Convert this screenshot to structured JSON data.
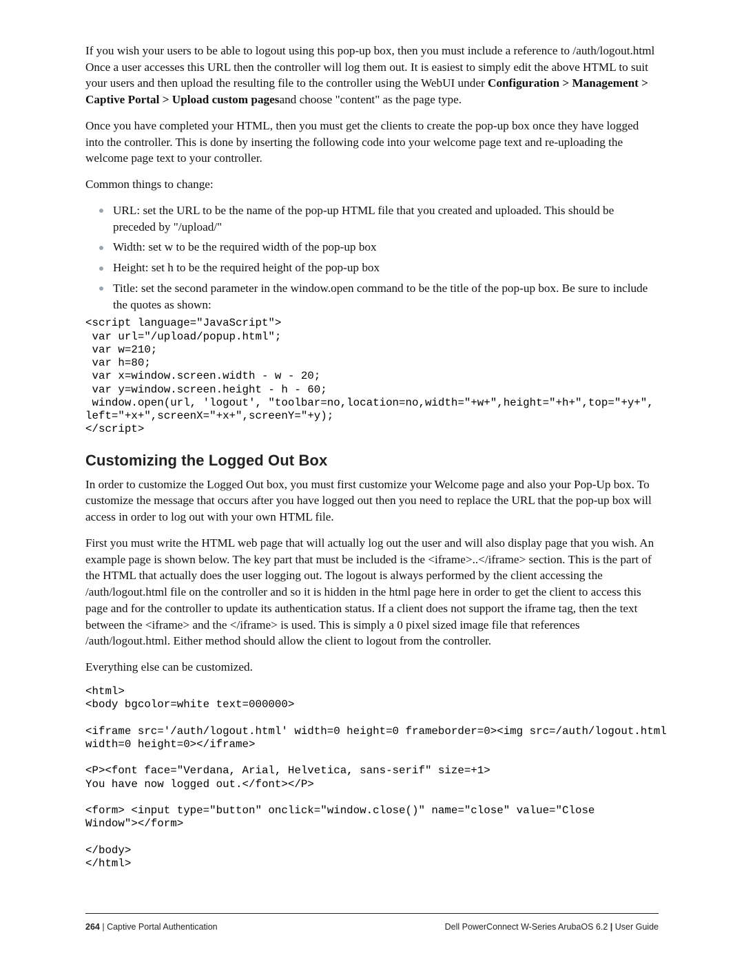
{
  "para1_part1": "If you wish your users to be able to logout using this pop-up box, then you must include a reference to /auth/logout.html Once a user accesses this URL then the controller will log them out. It is easiest to simply edit the above HTML to suit your users and then upload the resulting file to the controller using the WebUI under ",
  "para1_bold": "Configuration > Management > Captive Portal > Upload custom pages",
  "para1_part2": "and choose \"content\" as the page type.",
  "para2": "Once you have completed your HTML, then you must get the clients to create the pop-up box once they have logged into the controller. This is done by inserting the following code into your welcome page text and re-uploading the welcome page text to your controller.",
  "para3": "Common things to change:",
  "bullets": [
    "URL: set the URL to be the name of the pop-up HTML file that you created and uploaded. This should be preceded by \"/upload/\"",
    "Width: set w to be the required width of the pop-up box",
    "Height: set h to be the required height of the pop-up box",
    "Title: set the second parameter in the window.open command to be the title of the pop-up box. Be sure to include the quotes as shown:"
  ],
  "code1": "<script language=\"JavaScript\">\n var url=\"/upload/popup.html\";\n var w=210;\n var h=80;\n var x=window.screen.width - w - 20;\n var y=window.screen.height - h - 60;\n window.open(url, 'logout', \"toolbar=no,location=no,width=\"+w+\",height=\"+h+\",top=\"+y+\",\nleft=\"+x+\",screenX=\"+x+\",screenY=\"+y);\n</script>",
  "h2": "Customizing the Logged Out Box",
  "para4": "In order to customize the Logged Out box, you must first customize your Welcome page and also your Pop-Up box. To customize the message that occurs after you have logged out then you need to replace the URL that the pop-up box will access in order to log out with your own HTML file.",
  "para5": "First you must write the HTML web page that will actually log out the user and will also display page that you wish. An example page is shown below. The key part that must be included is the <iframe>..</iframe> section. This is the part of the HTML that actually does the user logging out. The logout is always performed by the client accessing the /auth/logout.html file on the controller and so it is hidden in the html page here in order to get the client to access this page and for the controller to update its authentication status. If a client does not support the iframe tag, then the text between the <iframe> and the </iframe> is used. This is simply a 0 pixel sized image file that references /auth/logout.html. Either method should allow the client to logout from the controller.",
  "para6": "Everything else can be customized.",
  "code2": "<html>\n<body bgcolor=white text=000000>\n\n<iframe src='/auth/logout.html' width=0 height=0 frameborder=0><img src=/auth/logout.html\nwidth=0 height=0></iframe>\n\n<P><font face=\"Verdana, Arial, Helvetica, sans-serif\" size=+1>\nYou have now logged out.</font></P>\n\n<form> <input type=\"button\" onclick=\"window.close()\" name=\"close\" value=\"Close\nWindow\"></form>\n\n</body>\n</html>",
  "footer": {
    "page_number": "264",
    "left_text": "Captive Portal Authentication",
    "right_text": "Dell PowerConnect W-Series ArubaOS 6.2",
    "right_suffix": "User Guide"
  }
}
